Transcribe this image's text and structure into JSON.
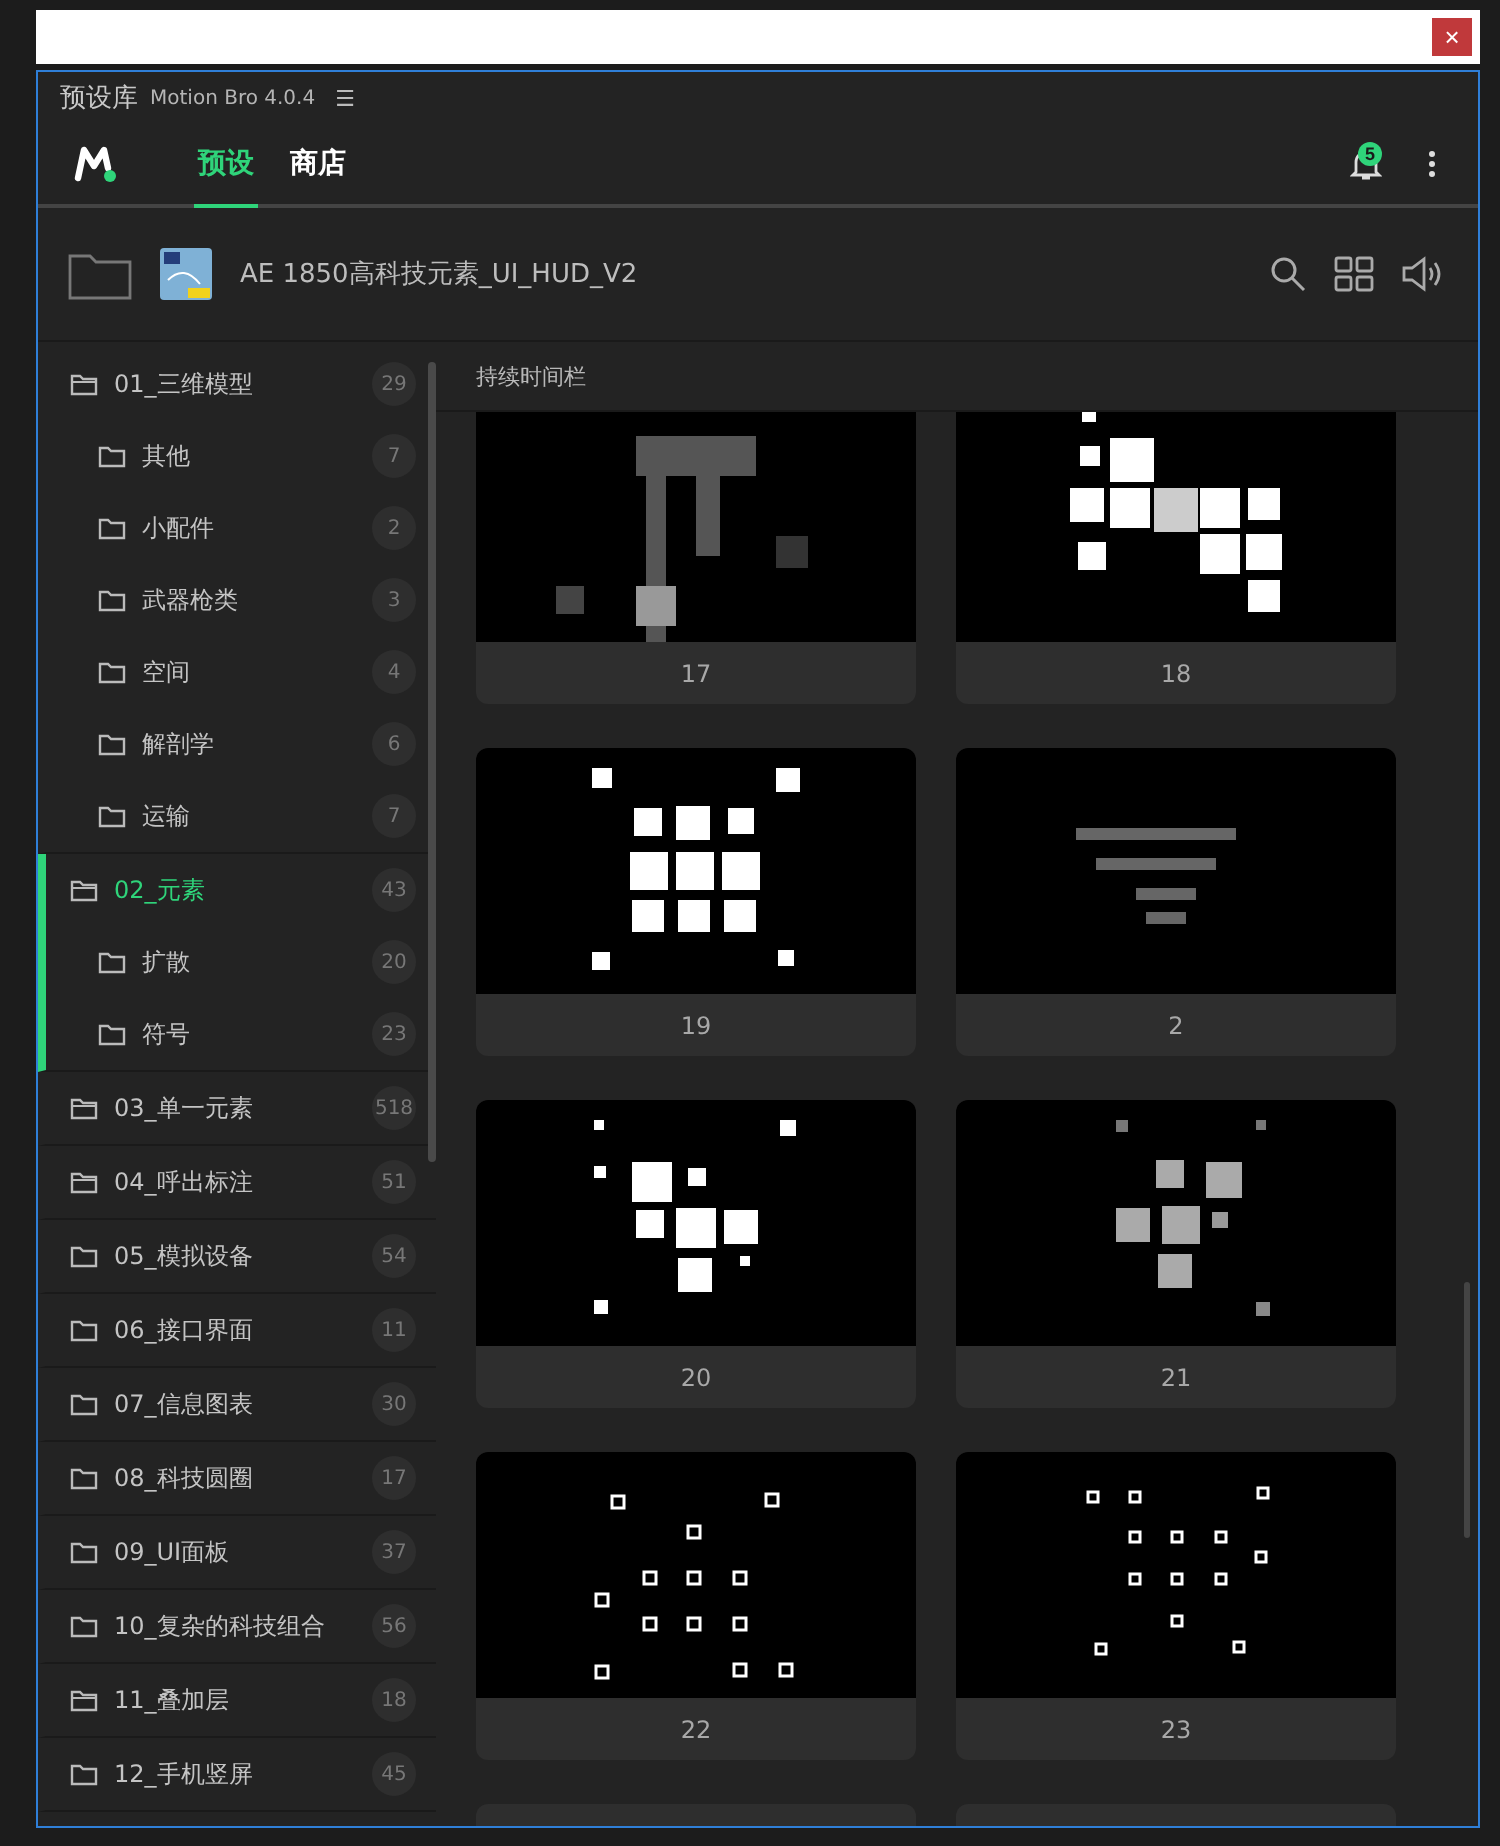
{
  "window": {
    "title": "预设库",
    "app": "Motion Bro 4.0.4",
    "menu_glyph": "☰",
    "close": "×"
  },
  "tabs": [
    {
      "label": "预设",
      "selected": true
    },
    {
      "label": "商店",
      "selected": false
    }
  ],
  "notifications": {
    "count": "5"
  },
  "pack": {
    "title": "AE 1850高科技元素_UI_HUD_V2"
  },
  "sidebar": {
    "folders": [
      {
        "label": "01_三维模型",
        "count": "29",
        "selected": false,
        "kind": "open",
        "children": [
          {
            "label": "其他",
            "count": "7"
          },
          {
            "label": "小配件",
            "count": "2"
          },
          {
            "label": "武器枪类",
            "count": "3"
          },
          {
            "label": "空间",
            "count": "4"
          },
          {
            "label": "解剖学",
            "count": "6"
          },
          {
            "label": "运输",
            "count": "7"
          }
        ]
      },
      {
        "label": "02_元素",
        "count": "43",
        "selected": true,
        "kind": "open",
        "children": [
          {
            "label": "扩散",
            "count": "20"
          },
          {
            "label": "符号",
            "count": "23"
          }
        ]
      },
      {
        "label": "03_单一元素",
        "count": "518",
        "selected": false,
        "kind": "open"
      },
      {
        "label": "04_呼出标注",
        "count": "51",
        "selected": false,
        "kind": "open"
      },
      {
        "label": "05_模拟设备",
        "count": "54",
        "selected": false,
        "kind": "closed"
      },
      {
        "label": "06_接口界面",
        "count": "11",
        "selected": false,
        "kind": "closed"
      },
      {
        "label": "07_信息图表",
        "count": "30",
        "selected": false,
        "kind": "closed"
      },
      {
        "label": "08_科技圆圈",
        "count": "17",
        "selected": false,
        "kind": "closed"
      },
      {
        "label": "09_UI面板",
        "count": "37",
        "selected": false,
        "kind": "closed"
      },
      {
        "label": "10_复杂的科技组合",
        "count": "56",
        "selected": false,
        "kind": "closed"
      },
      {
        "label": "11_叠加层",
        "count": "18",
        "selected": false,
        "kind": "open"
      },
      {
        "label": "12_手机竖屏",
        "count": "45",
        "selected": false,
        "kind": "closed"
      }
    ]
  },
  "content": {
    "heading": "持续时间栏",
    "presets": [
      {
        "label": "17"
      },
      {
        "label": "18"
      },
      {
        "label": "19"
      },
      {
        "label": "2"
      },
      {
        "label": "20"
      },
      {
        "label": "21"
      },
      {
        "label": "22"
      },
      {
        "label": "23"
      }
    ]
  }
}
